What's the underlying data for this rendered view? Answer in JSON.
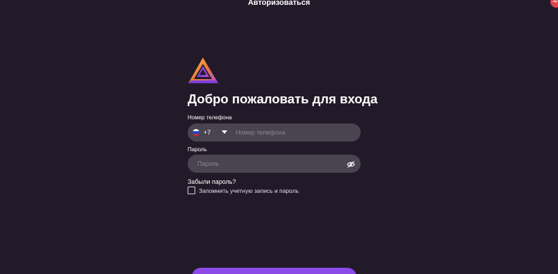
{
  "header": {
    "title": "Авторизоваться"
  },
  "logo": {
    "icon": "triangle-logo-icon",
    "colors": [
      "#f5c84b",
      "#ef7a3a",
      "#b44bd8",
      "#6b3fd1"
    ]
  },
  "form": {
    "heading": "Добро пожаловать для входа",
    "phone": {
      "label": "Номер телефона",
      "country_flag": "russia-flag-icon",
      "country_code": "+7",
      "placeholder": "Номер телефона",
      "value": ""
    },
    "password": {
      "label": "Пароль",
      "placeholder": "Пароль",
      "value": "",
      "visibility_icon": "eye-off-icon"
    },
    "forgot_link": "Забыли пароль?",
    "remember": {
      "label": "Запомнить учетную запись и пароль",
      "checked": false
    },
    "submit_color": "#8c4be8"
  },
  "colors": {
    "background": "#231a29",
    "field": "#4a4450",
    "corner_badge": "#e0464c"
  }
}
